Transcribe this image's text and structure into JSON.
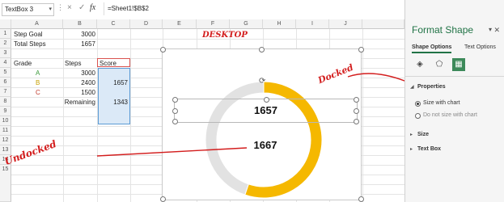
{
  "formula_bar": {
    "name_box": "TextBox 3",
    "dots": "⋮",
    "cancel_icon": "×",
    "enter_icon": "✓",
    "fx_label": "fx",
    "formula": "=Sheet1!$B$2"
  },
  "columns": [
    "A",
    "B",
    "C",
    "D",
    "E",
    "F",
    "G",
    "H",
    "I",
    "J"
  ],
  "rows": [
    "1",
    "2",
    "3",
    "4",
    "5",
    "6",
    "7",
    "8",
    "9",
    "10",
    "11",
    "12",
    "13",
    "14",
    "15"
  ],
  "cells": {
    "a1": "Step Goal",
    "b1": "3000",
    "a2": "Total Steps",
    "b2": "1657",
    "a4": "Grade",
    "b4": "Steps",
    "c4": "Score",
    "a5": "A",
    "b5": "3000",
    "a6": "B",
    "b6": "2400",
    "c6": "1657",
    "a7": "C",
    "b7": "1500",
    "b8": "Remaining",
    "c8": "1343"
  },
  "chart": {
    "type": "doughnut",
    "docked_value": "1657",
    "undocked_value": "1667",
    "segments": [
      {
        "label": "Score",
        "value": 1657,
        "color": "#f5b800"
      },
      {
        "label": "Remaining",
        "value": 1343,
        "color": "#e2e2e2"
      }
    ]
  },
  "annotations": {
    "desktop": "DESKTOP",
    "docked": "Docked",
    "undocked": "Undocked"
  },
  "panel": {
    "title": "Format Shape",
    "tab_shape_options": "Shape Options",
    "tab_text_options": "Text Options",
    "section_properties": "Properties",
    "radio_size_with_chart": "Size with chart",
    "radio_do_not_size": "Do not size with chart",
    "section_size": "Size",
    "section_text_box": "Text Box"
  },
  "colors": {
    "accent": "#217346",
    "gauge": "#f5b800",
    "annotation": "#d31d1d"
  }
}
